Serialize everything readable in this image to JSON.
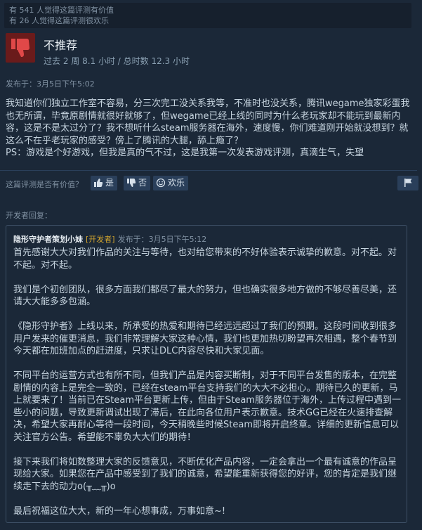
{
  "helpful": {
    "useful_count": "有 541 人觉得这篇评测有价值",
    "funny_count": "有 26 人觉得这篇评测很欢乐"
  },
  "verdict": {
    "icon": "thumbs-down-icon",
    "title": "不推荐",
    "hours": "过去 2 周 8.1 小时 / 总时数 12.3 小时"
  },
  "posted": "发布于：3月5日下午5:02",
  "review_lines": [
    "我知道你们独立工作室不容易，分三次完工没关系我等，不准时也没关系，腾讯wegame独家彩蛋我也无所谓，毕竟原剧情就很好就够了，但wegame已经上线的同时为什么老玩家却不能玩到最新内容，这是不是太过分了？我不想听什么steam服务器在海外，速度慢，你们难道刚开始就没想到？就这么不在乎老玩家的感受？傍上了腾讯的大腿，舔上瘾了？",
    "PS：游戏是个好游戏，但我是真的气不过，这是我第一次发表游戏评测，真滴生气，失望"
  ],
  "vote": {
    "question": "这篇评测是否有价值？",
    "yes": "是",
    "no": "否",
    "funny": "欢乐",
    "flag_icon": "flag-icon"
  },
  "developer_reply": {
    "label": "开发者回复：",
    "author": "隐形守护者策划小妹",
    "tag": "[开发者]",
    "time": "发布于：3月5日下午5:12",
    "paragraphs": [
      "首先感谢大大对我们作品的关注与等待，也对给您带来的不好体验表示诚挚的歉意。对不起。对不起。对不起。",
      "我们是个初创团队，很多方面我们都尽了最大的努力，但也确实很多地方做的不够尽善尽美，还请大大能多多包涵。",
      "《隐形守护者》上线以来，所承受的热爱和期待已经远远超过了我们的预期。这段时间收到很多用户发来的催更消息，我们非常理解大家这种心情，我们也更加热切盼望再次相遇，整个春节到今天都在加班加点的赶进度，只求让DLC内容尽快和大家见面。",
      "不同平台的运营方式也有所不同，但我们产品是内容买断制，对于不同平台发售的版本，在完整剧情的内容上是完全一致的，已经在steam平台支持我们的大大不必担心。期待已久的更新，马上就要来了！当前已在Steam平台更新上传，但由于Steam服务器位于海外，上传过程中遇到一些小的问题，导致更新调试出现了滞后，在此向各位用户表示歉意。技术GG已经在火速排查解决，希望大家再耐心等待一段时间，今天稍晚些时候Steam即将开启终章。详细的更新信息可以关注官方公告。希望能不辜负大大们的期待！",
      "接下来我们将如数整理大家的反馈意见，不断优化产品内容，一定会拿出一个最有诚意的作品呈现给大家。如果您在产品中感受到了我们的诚意，希望能重新获得您的好评，您的肯定是我们继续走下去的动力o(╥﹏╥)o",
      "最后祝福这位大大，新的一年心想事成，万事如意~!"
    ]
  }
}
